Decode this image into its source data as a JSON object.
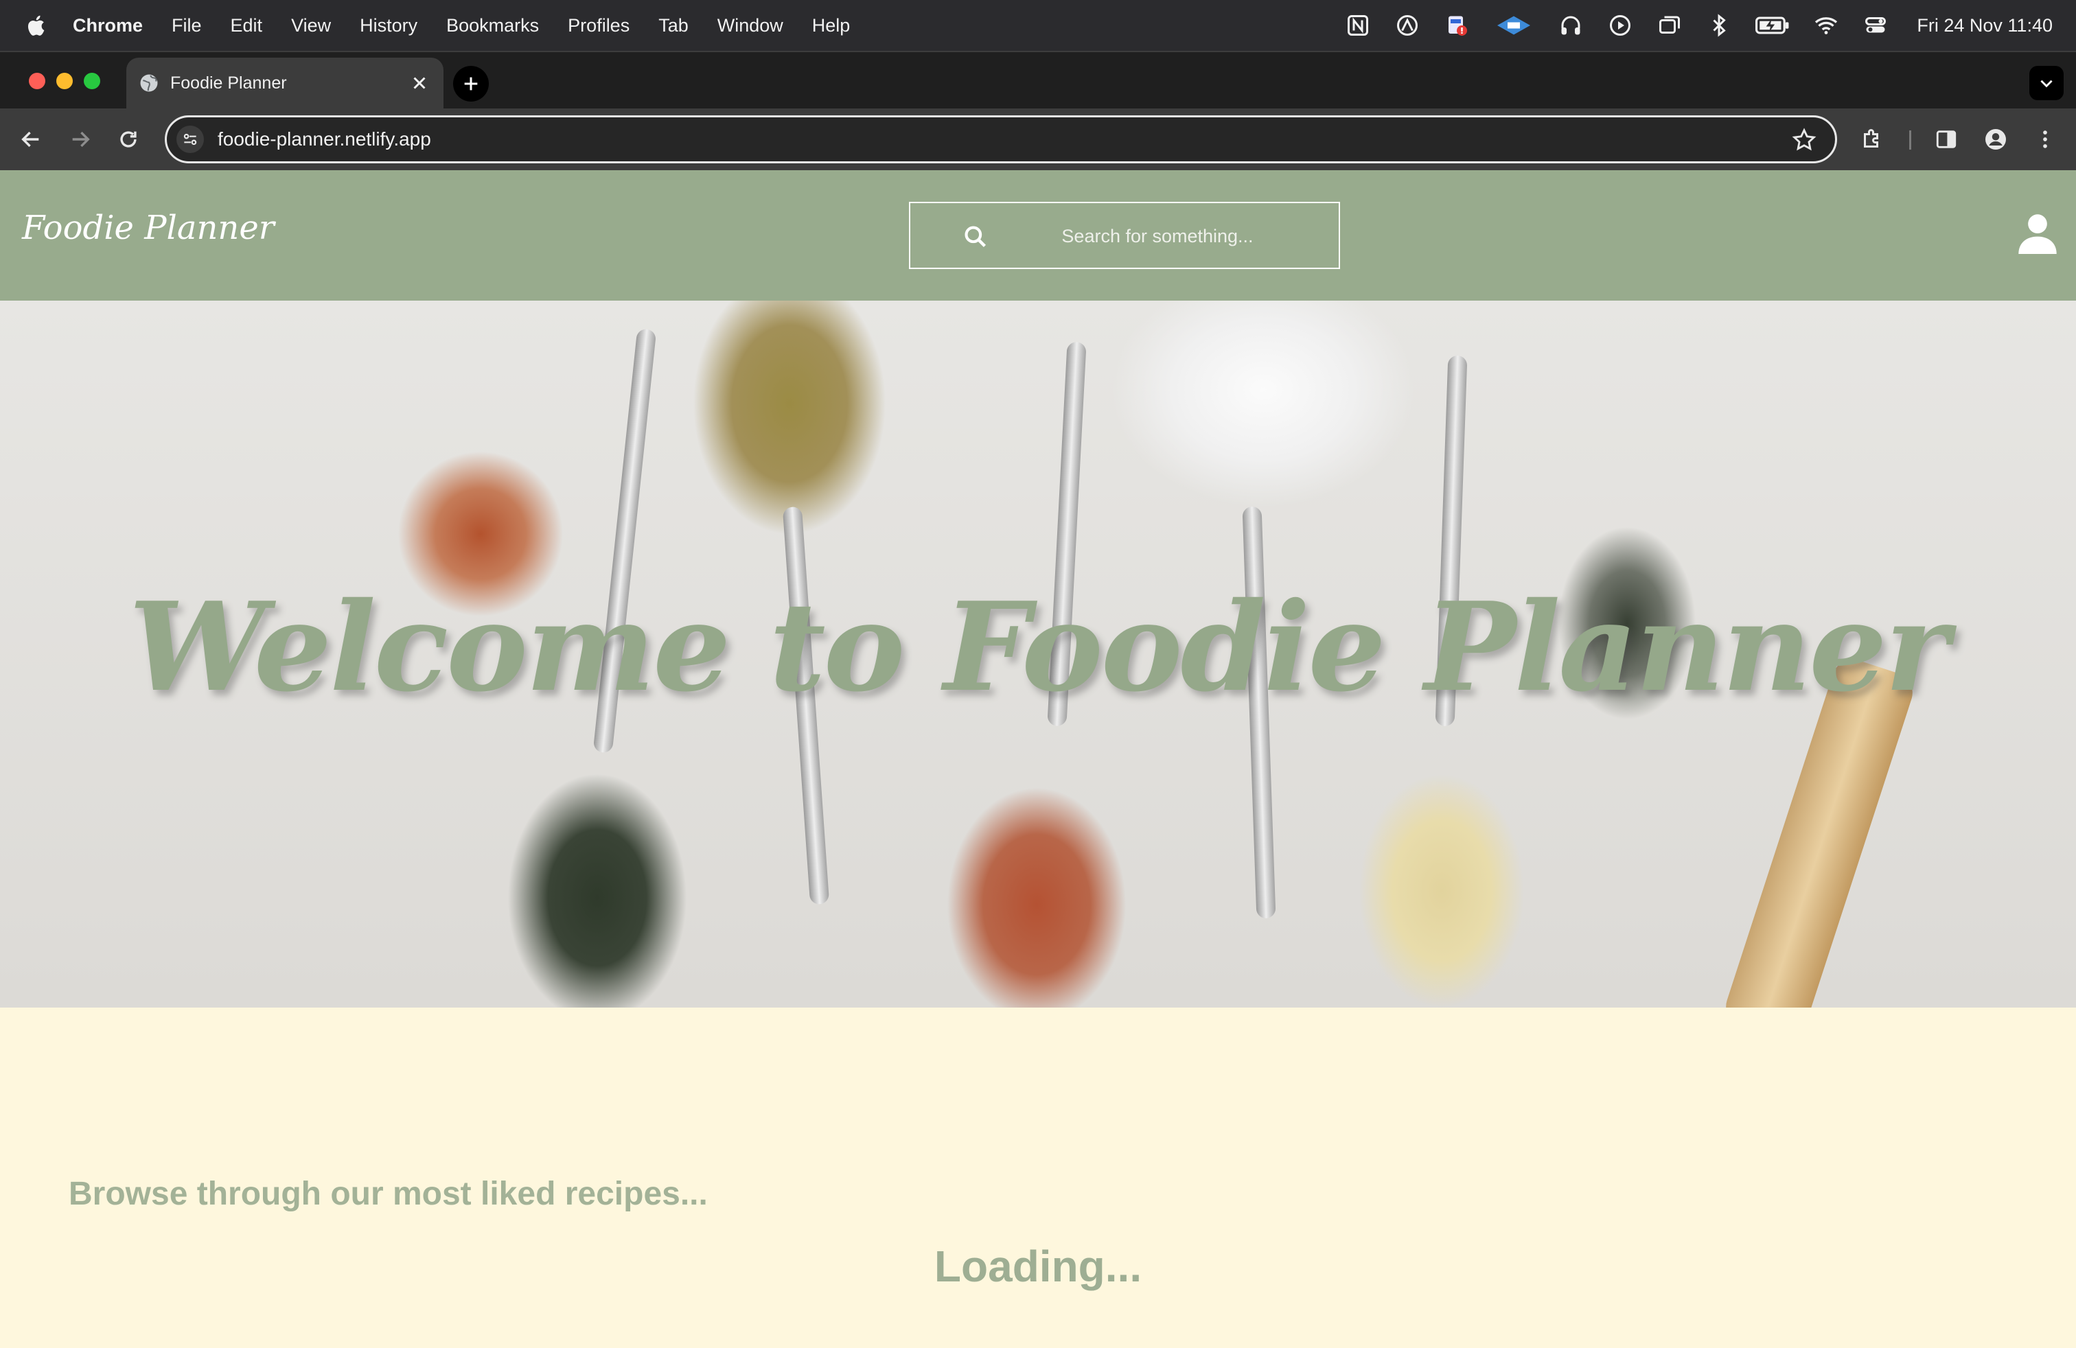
{
  "menubar": {
    "app_name": "Chrome",
    "items": [
      "File",
      "Edit",
      "View",
      "History",
      "Bookmarks",
      "Profiles",
      "Tab",
      "Window",
      "Help"
    ],
    "clock": "Fri 24 Nov  11:40",
    "status_icons": [
      "notion-icon",
      "arc-icon",
      "calendar-alert-icon",
      "vpn-icon",
      "headphones-icon",
      "play-icon",
      "screens-icon",
      "bluetooth-icon",
      "battery-charging-icon",
      "wifi-icon",
      "control-center-icon"
    ]
  },
  "browser": {
    "tab_title": "Foodie Planner",
    "url": "foodie-planner.netlify.app"
  },
  "site": {
    "brand": "Foodie Planner",
    "search_placeholder": "Search for something...",
    "hero_title": "Welcome to Foodie Planner",
    "browse_heading": "Browse through our most liked recipes...",
    "loading_text": "Loading..."
  },
  "colors": {
    "header_green": "#98ab8d",
    "page_cream": "#fef7dd",
    "title_green": "#95a88a"
  }
}
